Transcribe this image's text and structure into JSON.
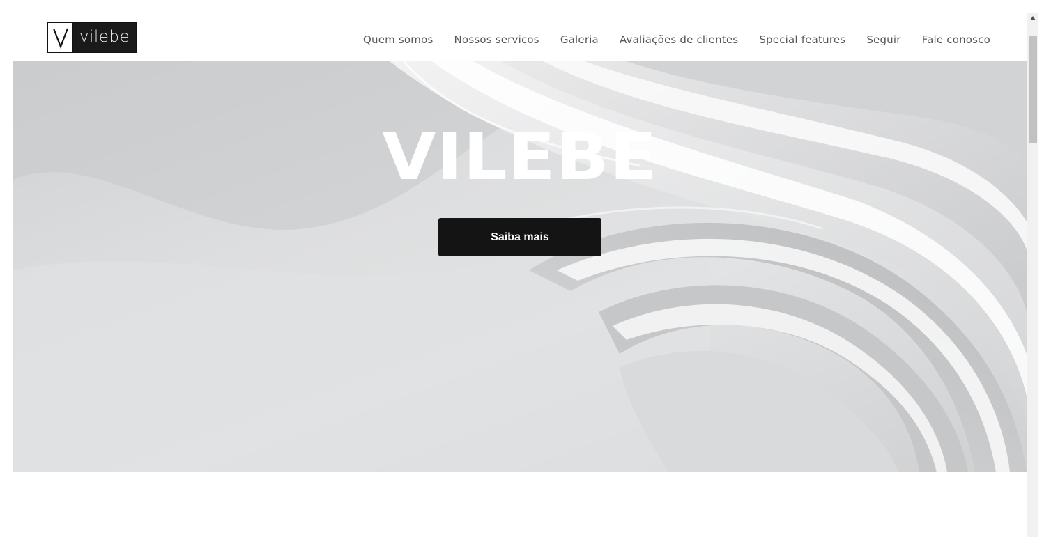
{
  "header": {
    "logo_text": "vilebe",
    "logo_mark": "V"
  },
  "nav": {
    "items": [
      {
        "label": "Quem somos"
      },
      {
        "label": "Nossos serviços"
      },
      {
        "label": "Galeria"
      },
      {
        "label": "Avaliações de clientes"
      },
      {
        "label": "Special features"
      },
      {
        "label": "Seguir"
      },
      {
        "label": "Fale conosco"
      }
    ]
  },
  "hero": {
    "title": "VILEBE",
    "button_label": "Saiba mais"
  },
  "colors": {
    "button_bg": "#141414",
    "nav_text": "#555555",
    "hero_bg": "#dcdddf"
  },
  "icons": {
    "scroll_up": "triangle-up-icon"
  }
}
